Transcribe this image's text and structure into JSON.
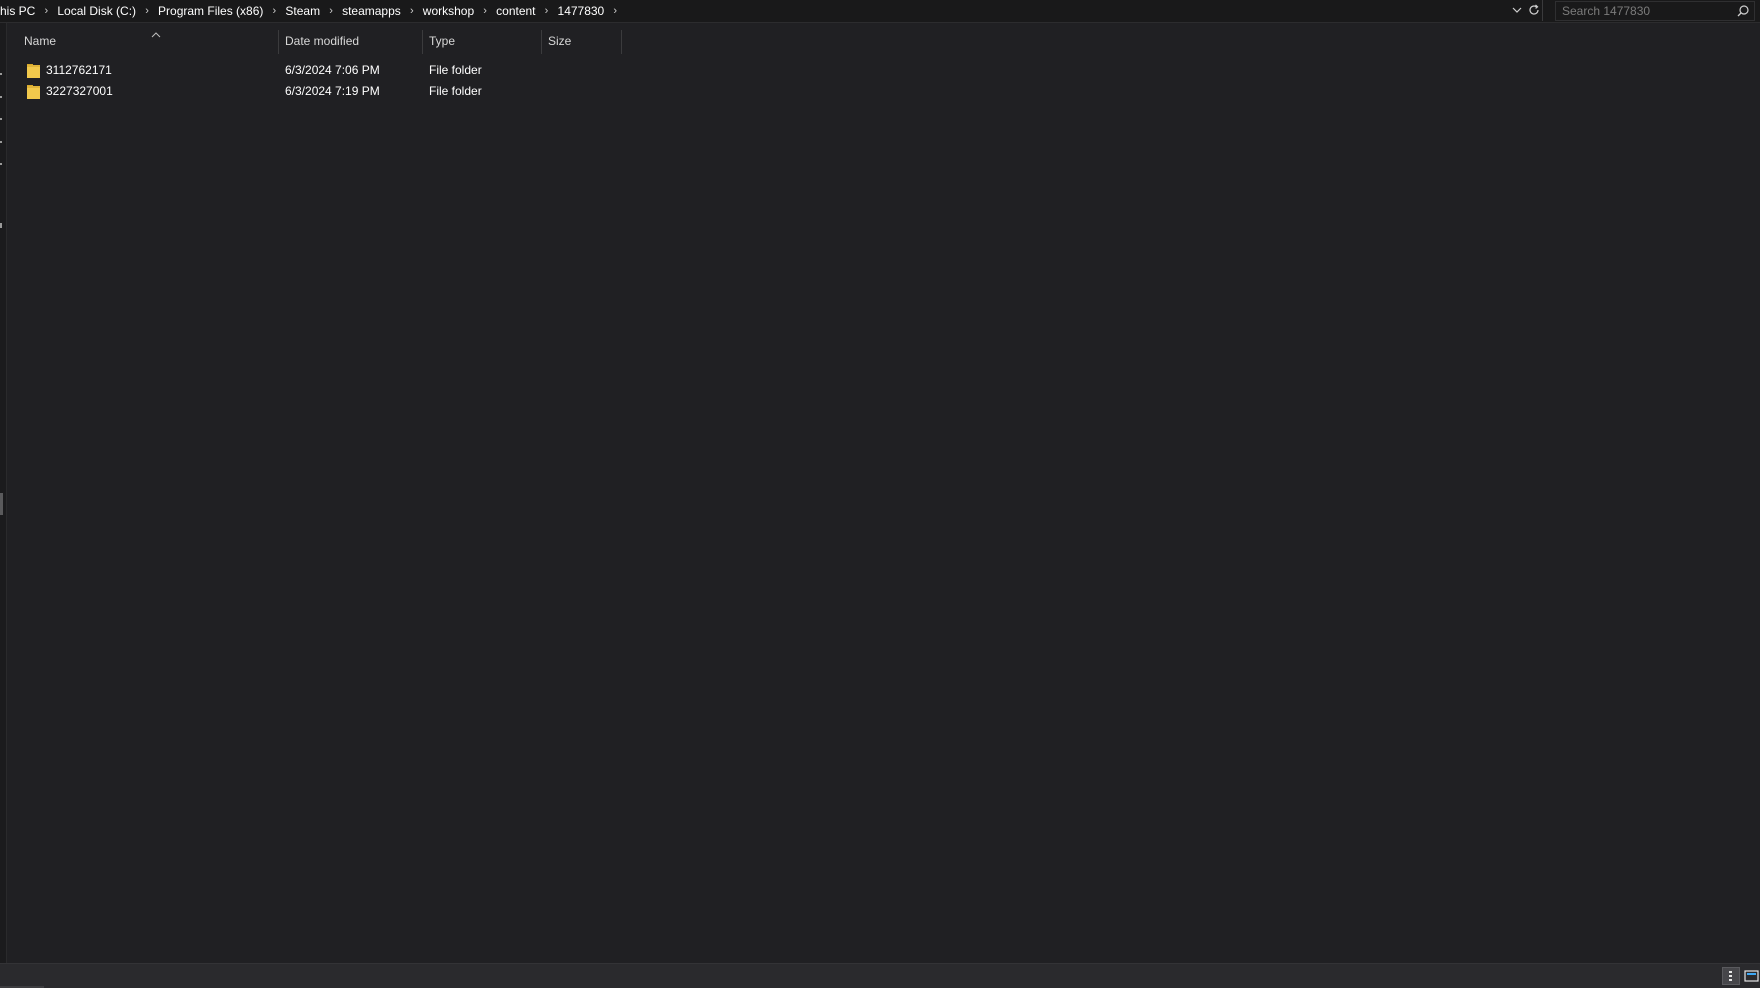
{
  "breadcrumb": {
    "items": [
      "his PC",
      "Local Disk (C:)",
      "Program Files (x86)",
      "Steam",
      "steamapps",
      "workshop",
      "content",
      "1477830"
    ],
    "separator": "›"
  },
  "search": {
    "placeholder": "Search 1477830"
  },
  "columns": {
    "name": "Name",
    "date": "Date modified",
    "type": "Type",
    "size": "Size",
    "sort": "ascending"
  },
  "files": [
    {
      "name": "3112762171",
      "date": "6/3/2024 7:06 PM",
      "type": "File folder",
      "size": ""
    },
    {
      "name": "3227327001",
      "date": "6/3/2024 7:19 PM",
      "type": "File folder",
      "size": ""
    }
  ],
  "icons": {
    "folder": "folder-icon",
    "search": "search-icon",
    "refresh": "refresh-icon",
    "dropdown": "chevron-down-icon"
  },
  "colors": {
    "background": "#202023",
    "folder": "#f2c94c",
    "text": "#ffffff"
  }
}
